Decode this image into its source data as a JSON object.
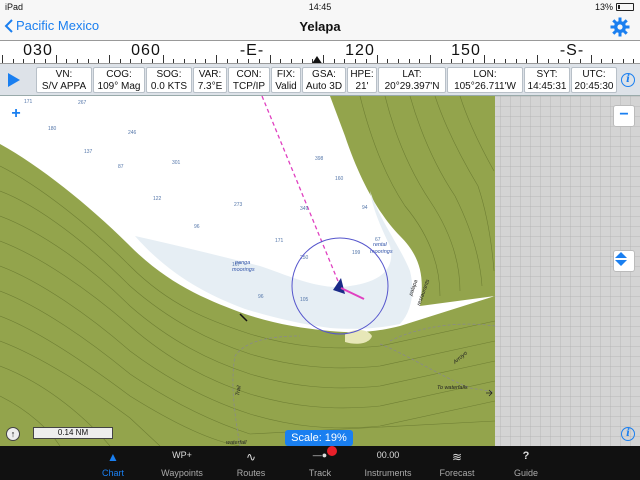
{
  "status": {
    "device": "iPad",
    "time": "14:45",
    "battery": "13%"
  },
  "nav": {
    "back_label": "Pacific Mexico",
    "title": "Yelapa"
  },
  "compass": {
    "labels": [
      "030",
      "060",
      "-E-",
      "120",
      "150",
      "-S-"
    ]
  },
  "databar": [
    {
      "label": "VN:",
      "value": "S/V APPA"
    },
    {
      "label": "COG:",
      "value": "109° Mag"
    },
    {
      "label": "SOG:",
      "value": "0.0 KTS"
    },
    {
      "label": "VAR:",
      "value": "7.3°E"
    },
    {
      "label": "CON:",
      "value": "TCP/IP"
    },
    {
      "label": "FIX:",
      "value": "Valid"
    },
    {
      "label": "GSA:",
      "value": "Auto 3D"
    },
    {
      "label": "HPE:",
      "value": "21'"
    },
    {
      "label": "LAT:",
      "value": "20°29.397'N"
    },
    {
      "label": "LON:",
      "value": "105°26.711'W"
    },
    {
      "label": "SYT:",
      "value": "14:45:31"
    },
    {
      "label": "UTC:",
      "value": "20:45:30"
    }
  ],
  "map": {
    "soundings": [
      "171",
      "267",
      "180",
      "246",
      "137",
      "87",
      "301",
      "122",
      "273",
      "96",
      "171",
      "167",
      "96",
      "105",
      "250",
      "199",
      "67",
      "398",
      "160",
      "94",
      "349"
    ],
    "labels": {
      "panga": "panga",
      "moorings1": "moorings",
      "rental": "rental",
      "moorings2": "moorings",
      "palapa": "palapa",
      "restaurants": "restaurants",
      "arroyo": "Arroyo",
      "waterfalls": "To waterfalls",
      "trail": "Trail",
      "waterfall": "waterfall"
    },
    "scale_bar": "0.14 NM",
    "scale_button": "Scale: 19%",
    "zoom_in": "+",
    "zoom_out": "−"
  },
  "tabs": [
    {
      "label": "Chart",
      "icon": "▲",
      "active": true
    },
    {
      "label": "Waypoints",
      "icon": "WP+"
    },
    {
      "label": "Routes",
      "icon": "∿"
    },
    {
      "label": "Track",
      "icon": "—●"
    },
    {
      "label": "Instruments",
      "icon": "00.00"
    },
    {
      "label": "Forecast",
      "icon": "≋"
    },
    {
      "label": "Guide",
      "icon": "?"
    }
  ]
}
